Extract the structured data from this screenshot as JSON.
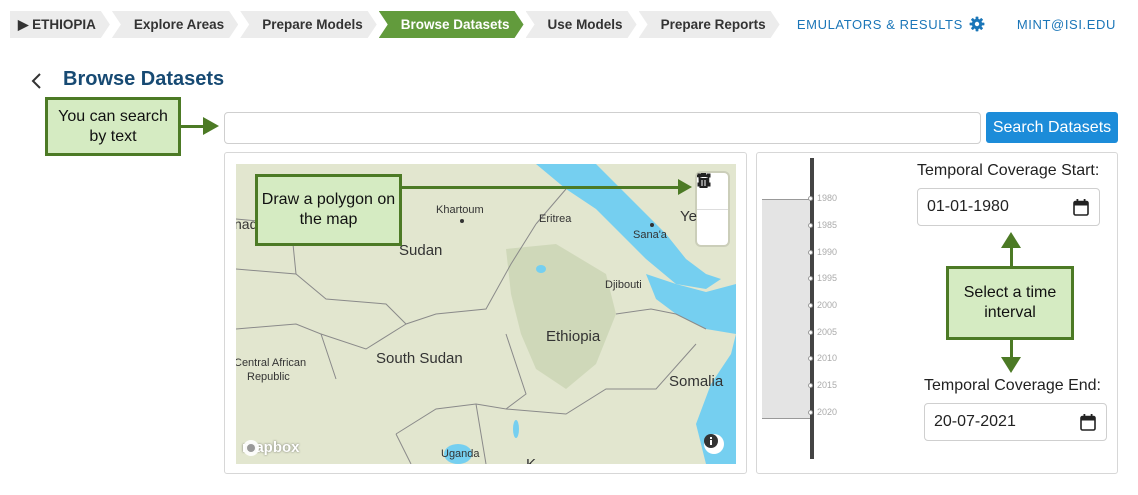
{
  "breadcrumb": [
    {
      "label": "▶ ETHIOPIA"
    },
    {
      "label": "Explore Areas"
    },
    {
      "label": "Prepare Models"
    },
    {
      "label": "Browse Datasets"
    },
    {
      "label": "Use Models"
    },
    {
      "label": "Prepare Reports"
    }
  ],
  "topnav": {
    "emulators": "EMULATORS & RESULTS",
    "user": "MINT@ISI.EDU"
  },
  "page": {
    "title": "Browse Datasets",
    "back_icon": "chevron-left-icon"
  },
  "search": {
    "placeholder": "",
    "value": "",
    "button_label": "Search Datasets"
  },
  "callouts": {
    "search": "You can search by text",
    "polygon": "Draw a polygon on the map",
    "time": "Select a time interval"
  },
  "map": {
    "labels": {
      "sudan": "Sudan",
      "khartoum": "Khartoum",
      "eritrea": "Eritrea",
      "sanaa": "Sana'a",
      "yemen": "Yemen",
      "djibouti": "Djibouti",
      "ethiopia": "Ethiopia",
      "south_sudan": "South Sudan",
      "car1": "Central African",
      "car2": "Republic",
      "somalia": "Somalia",
      "uganda": "Uganda",
      "chad": "nad",
      "kenya": "K"
    },
    "attribution": "mapbox",
    "colors": {
      "land": "#e2e6cf",
      "water": "#75cff0",
      "highlands": "#cfd8b9",
      "border": "#8a8a8a"
    }
  },
  "timeline": {
    "ticks": [
      "1980",
      "1985",
      "1990",
      "1995",
      "2000",
      "2005",
      "2010",
      "2015",
      "2020"
    ]
  },
  "temporal": {
    "start_label": "Temporal Coverage Start:",
    "start_value": "01-01-1980",
    "end_label": "Temporal Coverage End:",
    "end_value": "20-07-2021"
  },
  "colors": {
    "accent": "#629b3c",
    "primary": "#1c8cd9",
    "title": "#174a73",
    "callout_bg": "#d5ebc2",
    "callout_border": "#4c7a25"
  }
}
